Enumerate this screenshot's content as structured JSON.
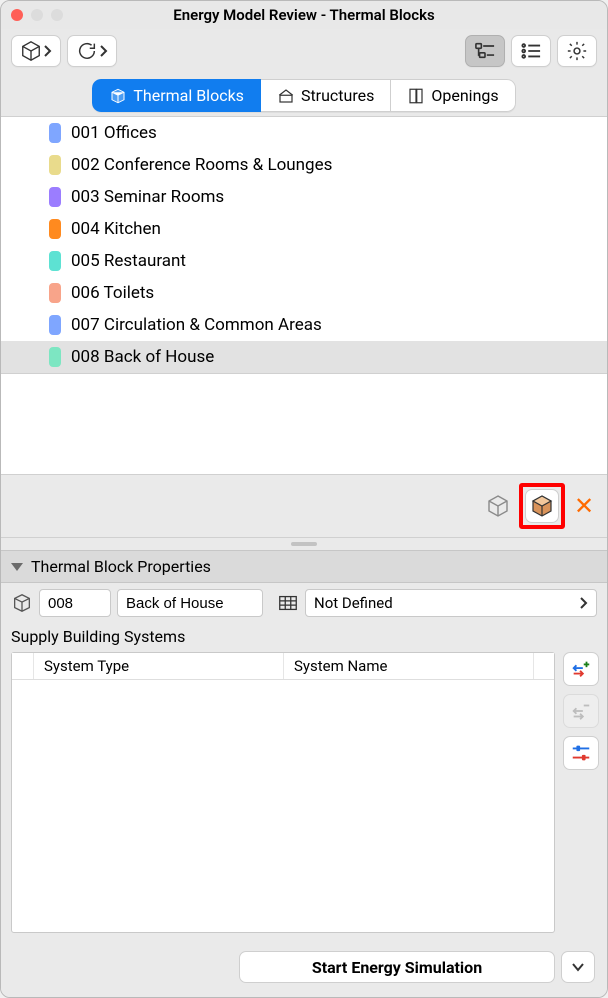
{
  "window": {
    "title": "Energy Model Review - Thermal Blocks"
  },
  "tabs": {
    "thermal": "Thermal Blocks",
    "structures": "Structures",
    "openings": "Openings"
  },
  "blocks": [
    {
      "color": "#7fa6ff",
      "label": "001 Offices"
    },
    {
      "color": "#e9db8c",
      "label": "002 Conference Rooms & Lounges"
    },
    {
      "color": "#9b7dff",
      "label": "003 Seminar Rooms"
    },
    {
      "color": "#ff8a1f",
      "label": "004 Kitchen"
    },
    {
      "color": "#5de2d3",
      "label": "005 Restaurant"
    },
    {
      "color": "#f8a48a",
      "label": "006 Toilets"
    },
    {
      "color": "#7fa6ff",
      "label": "007 Circulation & Common Areas"
    },
    {
      "color": "#7de6c2",
      "label": "008 Back of House"
    }
  ],
  "selected_index": 7,
  "properties": {
    "header": "Thermal Block Properties",
    "id": "008",
    "name": "Back of House",
    "profile": "Not Defined"
  },
  "systems": {
    "title": "Supply Building Systems",
    "col_type": "System Type",
    "col_name": "System Name",
    "rows": []
  },
  "footer": {
    "start": "Start Energy Simulation"
  }
}
